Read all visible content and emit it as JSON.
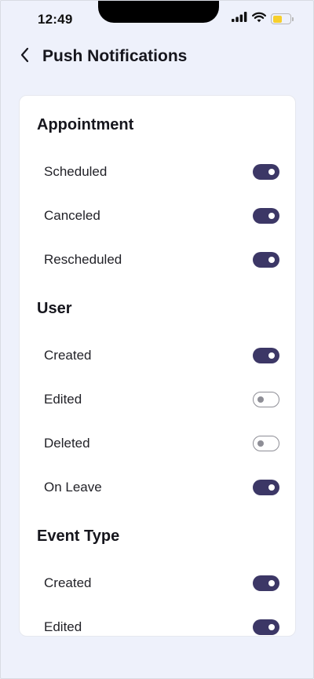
{
  "status_bar": {
    "time": "12:49",
    "battery_level": 0.55,
    "battery_color": "#f7cf2b"
  },
  "header": {
    "back_icon": "chevron-left-icon",
    "title": "Push Notifications"
  },
  "colors": {
    "accent": "#3c3766",
    "background": "#eef1fb"
  },
  "sections": [
    {
      "title": "Appointment",
      "items": [
        {
          "label": "Scheduled",
          "enabled": true
        },
        {
          "label": "Canceled",
          "enabled": true
        },
        {
          "label": "Rescheduled",
          "enabled": true
        }
      ]
    },
    {
      "title": "User",
      "items": [
        {
          "label": "Created",
          "enabled": true
        },
        {
          "label": "Edited",
          "enabled": false
        },
        {
          "label": "Deleted",
          "enabled": false
        },
        {
          "label": "On Leave",
          "enabled": true
        }
      ]
    },
    {
      "title": "Event Type",
      "items": [
        {
          "label": "Created",
          "enabled": true
        },
        {
          "label": "Edited",
          "enabled": true
        }
      ]
    }
  ]
}
